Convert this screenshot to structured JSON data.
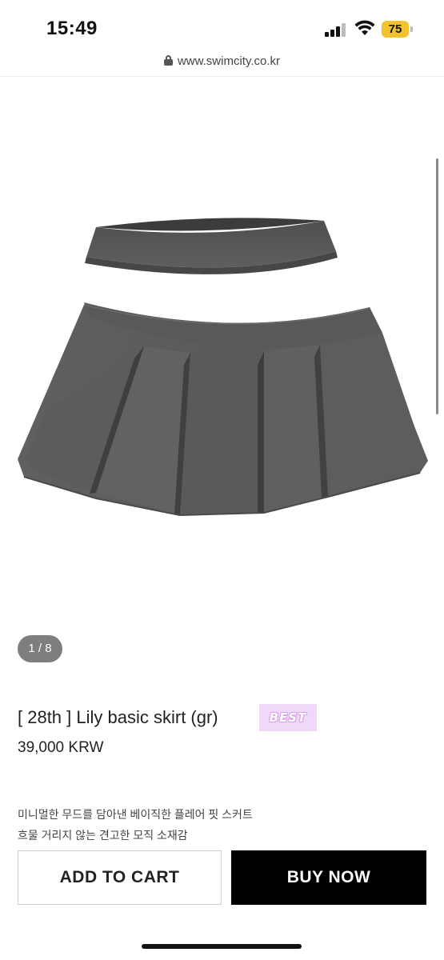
{
  "status_bar": {
    "time": "15:49",
    "battery_level": "75",
    "battery_color": "#f2c230"
  },
  "browser": {
    "url": "www.swimcity.co.kr"
  },
  "product": {
    "image_counter": "1 / 8",
    "title": "[ 28th ] Lily basic skirt (gr)",
    "badge": "BEST",
    "price": "39,000 KRW",
    "description": [
      "미니멀한 무드를 담아낸 베이직한 플레어 핏 스커트",
      "흐물 거리지 않는 견고한 모직 소재감"
    ]
  },
  "actions": {
    "add_to_cart": "ADD TO CART",
    "buy_now": "BUY NOW"
  },
  "icons": [
    "signal-icon",
    "wifi-icon",
    "battery-icon",
    "lock-icon"
  ],
  "colors": {
    "skirt": "#58585a",
    "buy_button": "#000000",
    "badge_bg": "#f1d7f8"
  }
}
